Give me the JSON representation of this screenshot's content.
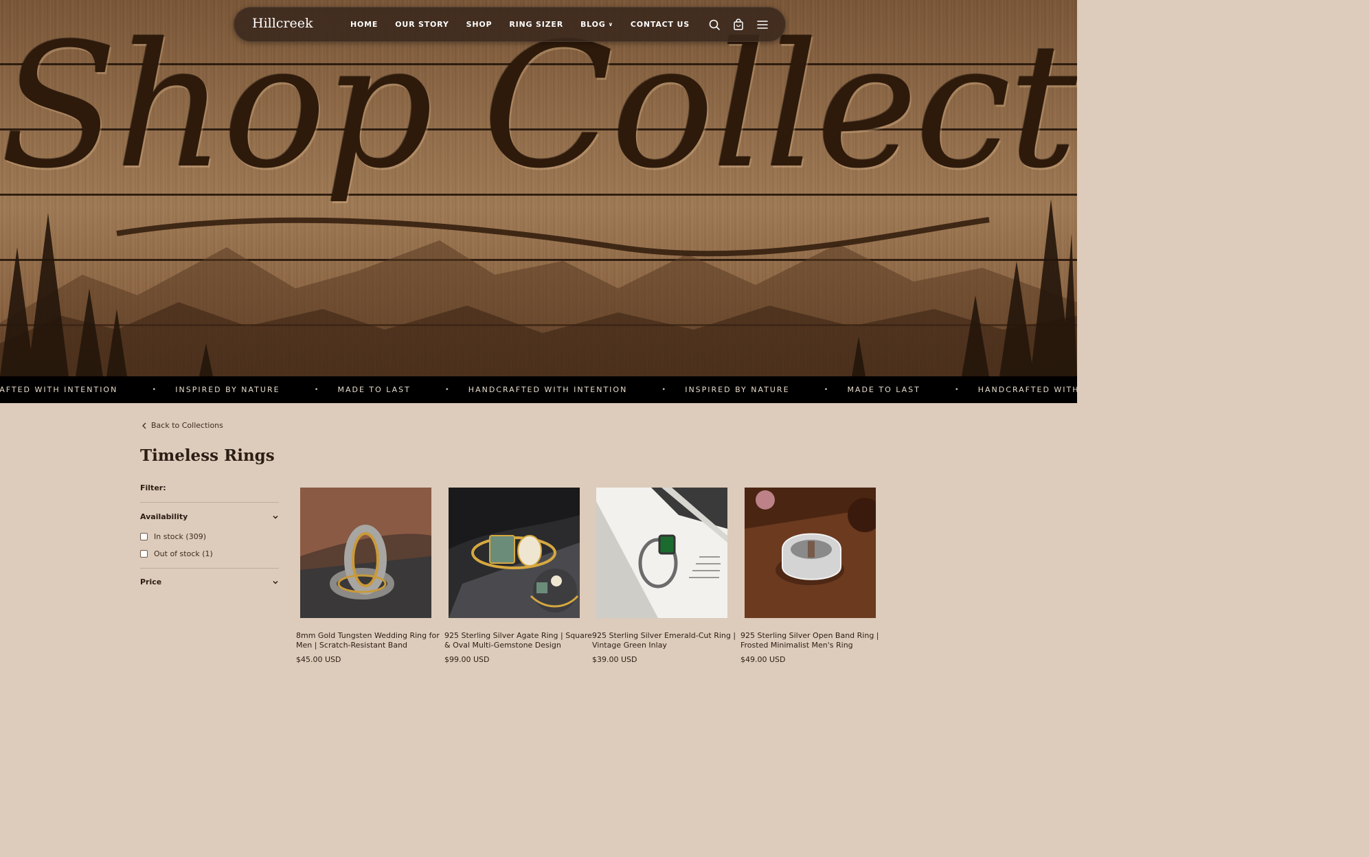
{
  "hero": {
    "title": "Shop Collections"
  },
  "nav": {
    "brand": "Hillcreek",
    "links": [
      {
        "label": "HOME"
      },
      {
        "label": "OUR STORY"
      },
      {
        "label": "SHOP"
      },
      {
        "label": "RING SIZER"
      },
      {
        "label": "BLOG"
      },
      {
        "label": "CONTACT US"
      }
    ],
    "icons": [
      "search-icon",
      "cart-icon",
      "menu-icon"
    ]
  },
  "marquee": {
    "items": [
      "RAFTED WITH INTENTION",
      "INSPIRED BY NATURE",
      "MADE TO LAST",
      "HANDCRAFTED WITH INTENTION",
      "INSPIRED BY NATURE",
      "MADE TO LAST",
      "HANDCRAFTED WITH INTENTION"
    ],
    "separator": "•"
  },
  "collection": {
    "back_label": "Back to Collections",
    "title": "Timeless Rings",
    "filter_label": "Filter:",
    "availability": {
      "label": "Availability",
      "options": [
        {
          "label": "In stock (309)",
          "checked": false
        },
        {
          "label": "Out of stock (1)",
          "checked": false
        }
      ]
    },
    "price": {
      "label": "Price"
    }
  },
  "products": [
    {
      "name": "8mm Gold Tungsten Wedding Ring for Men | Scratch-Resistant Band",
      "price": "$45.00 USD"
    },
    {
      "name": "925 Sterling Silver Agate Ring | Square & Oval Multi-Gemstone Design",
      "price": "$99.00 USD"
    },
    {
      "name": "925 Sterling Silver Emerald-Cut Ring | Vintage Green Inlay",
      "price": "$39.00 USD"
    },
    {
      "name": "925 Sterling Silver Open Band Ring | Frosted Minimalist Men's Ring",
      "price": "$49.00 USD"
    }
  ],
  "colors": {
    "page_bg": "#ddcbbb",
    "nav_bg": "#3a281c",
    "marquee_bg": "#000000",
    "text": "#2a1d14"
  }
}
